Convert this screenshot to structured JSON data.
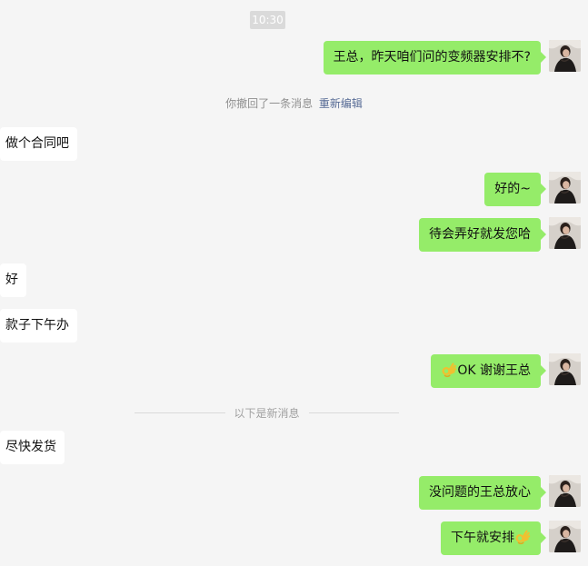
{
  "chat": {
    "timestamp": "10:30",
    "system_message": "你撤回了一条消息",
    "system_action": "重新编辑",
    "new_messages_divider": "以下是新消息"
  },
  "messages": [
    {
      "side": "out",
      "text": "王总，昨天咱们问的变频器安排不?"
    },
    {
      "side": "in",
      "text": "做个合同吧"
    },
    {
      "side": "out",
      "text": "好的~"
    },
    {
      "side": "out",
      "text": "待会弄好就发您哈"
    },
    {
      "side": "in",
      "text": "好"
    },
    {
      "side": "in",
      "text": "款子下午办"
    },
    {
      "side": "out",
      "emoji_prefix": "ok-hand-emoji",
      "text": "OK  谢谢王总"
    },
    {
      "side": "in",
      "text": "尽快发货"
    },
    {
      "side": "out",
      "text": "没问题的王总放心"
    },
    {
      "side": "out",
      "text": "下午就安排",
      "emoji_suffix": "ok-hand-emoji"
    }
  ],
  "colors": {
    "background": "#f5f5f5",
    "outgoing_bubble": "#95ec69",
    "incoming_bubble": "#ffffff",
    "system_link": "#576b95",
    "timestamp_badge": "#dadada"
  }
}
